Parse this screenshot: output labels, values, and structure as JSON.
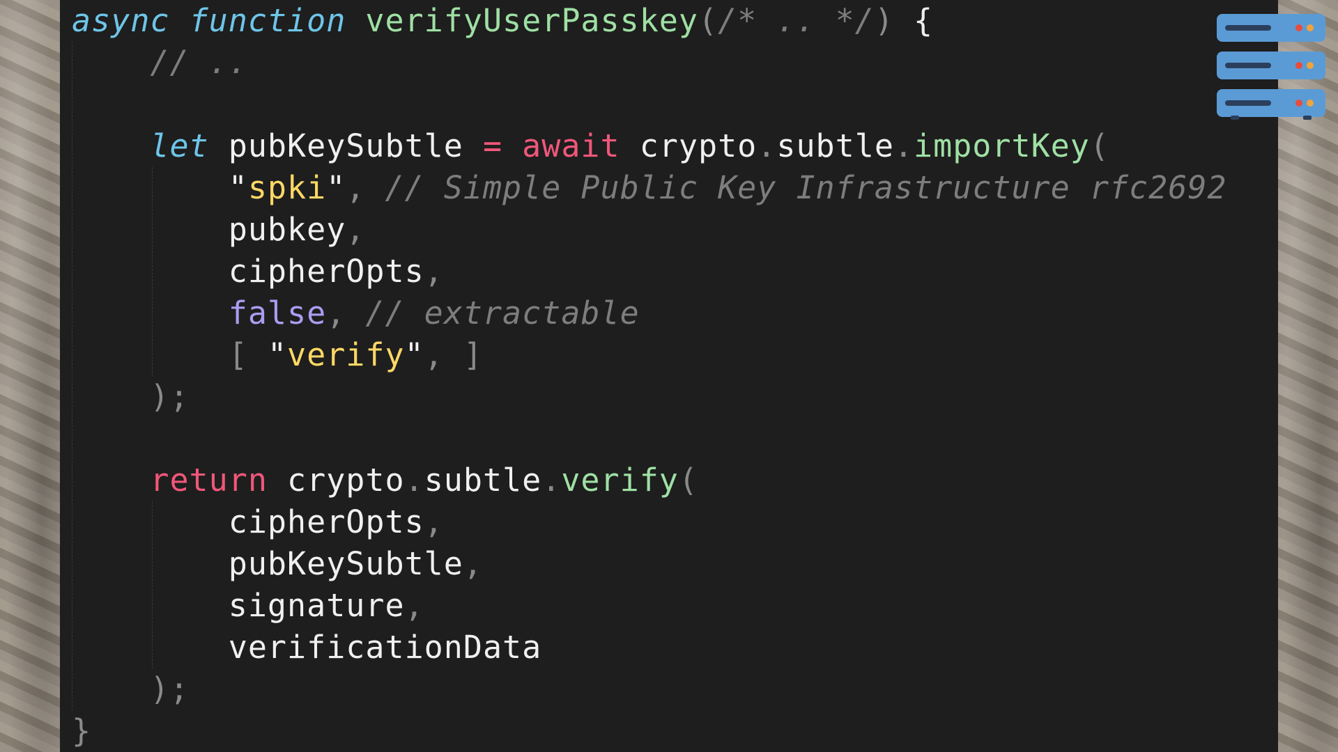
{
  "code": {
    "lines": [
      [
        [
          "async",
          "kw"
        ],
        [
          " ",
          ""
        ],
        [
          "function",
          "kw"
        ],
        [
          " ",
          ""
        ],
        [
          "verifyUserPasskey",
          "fn"
        ],
        [
          "(",
          "pn"
        ],
        [
          "/* .. */",
          "cm"
        ],
        [
          ")",
          "pn"
        ],
        [
          " {",
          ""
        ]
      ],
      [
        [
          "    ",
          ""
        ],
        [
          "// ..",
          "cm"
        ]
      ],
      [],
      [
        [
          "    ",
          ""
        ],
        [
          "let",
          "kw"
        ],
        [
          " pubKeySubtle ",
          ""
        ],
        [
          "=",
          "red"
        ],
        [
          " ",
          ""
        ],
        [
          "await",
          "red"
        ],
        [
          " crypto",
          ""
        ],
        [
          ".",
          "pn"
        ],
        [
          "subtle",
          ""
        ],
        [
          ".",
          "pn"
        ],
        [
          "importKey",
          "fn"
        ],
        [
          "(",
          "pn"
        ]
      ],
      [
        [
          "        ",
          ""
        ],
        [
          "\"",
          ""
        ],
        [
          "spki",
          "str"
        ],
        [
          "\"",
          ""
        ],
        [
          ", ",
          "pn"
        ],
        [
          "// Simple Public Key Infrastructure rfc2692",
          "cm"
        ]
      ],
      [
        [
          "        pubkey",
          ""
        ],
        [
          ",",
          "pn"
        ]
      ],
      [
        [
          "        cipherOpts",
          ""
        ],
        [
          ",",
          "pn"
        ]
      ],
      [
        [
          "        ",
          ""
        ],
        [
          "false",
          "bool"
        ],
        [
          ", ",
          "pn"
        ],
        [
          "// extractable",
          "cm"
        ]
      ],
      [
        [
          "        ",
          ""
        ],
        [
          "[ ",
          "pn"
        ],
        [
          "\"",
          ""
        ],
        [
          "verify",
          "str"
        ],
        [
          "\"",
          ""
        ],
        [
          ", ]",
          "pn"
        ]
      ],
      [
        [
          "    ",
          ""
        ],
        [
          ");",
          "pn"
        ]
      ],
      [],
      [
        [
          "    ",
          ""
        ],
        [
          "return",
          "red"
        ],
        [
          " crypto",
          ""
        ],
        [
          ".",
          "pn"
        ],
        [
          "subtle",
          ""
        ],
        [
          ".",
          "pn"
        ],
        [
          "verify",
          "fn"
        ],
        [
          "(",
          "pn"
        ]
      ],
      [
        [
          "        cipherOpts",
          ""
        ],
        [
          ",",
          "pn"
        ]
      ],
      [
        [
          "        pubKeySubtle",
          ""
        ],
        [
          ",",
          "pn"
        ]
      ],
      [
        [
          "        signature",
          ""
        ],
        [
          ",",
          "pn"
        ]
      ],
      [
        [
          "        verificationData",
          ""
        ]
      ],
      [
        [
          "    ",
          ""
        ],
        [
          ");",
          "pn"
        ]
      ],
      [
        [
          "}",
          "pn"
        ]
      ]
    ]
  },
  "icon": {
    "name": "server-stack-icon",
    "colors": {
      "panel": "#5b9bd5",
      "bar": "#2b3f5c",
      "led_red": "#e84c3d",
      "led_orange": "#f2a33a"
    }
  }
}
